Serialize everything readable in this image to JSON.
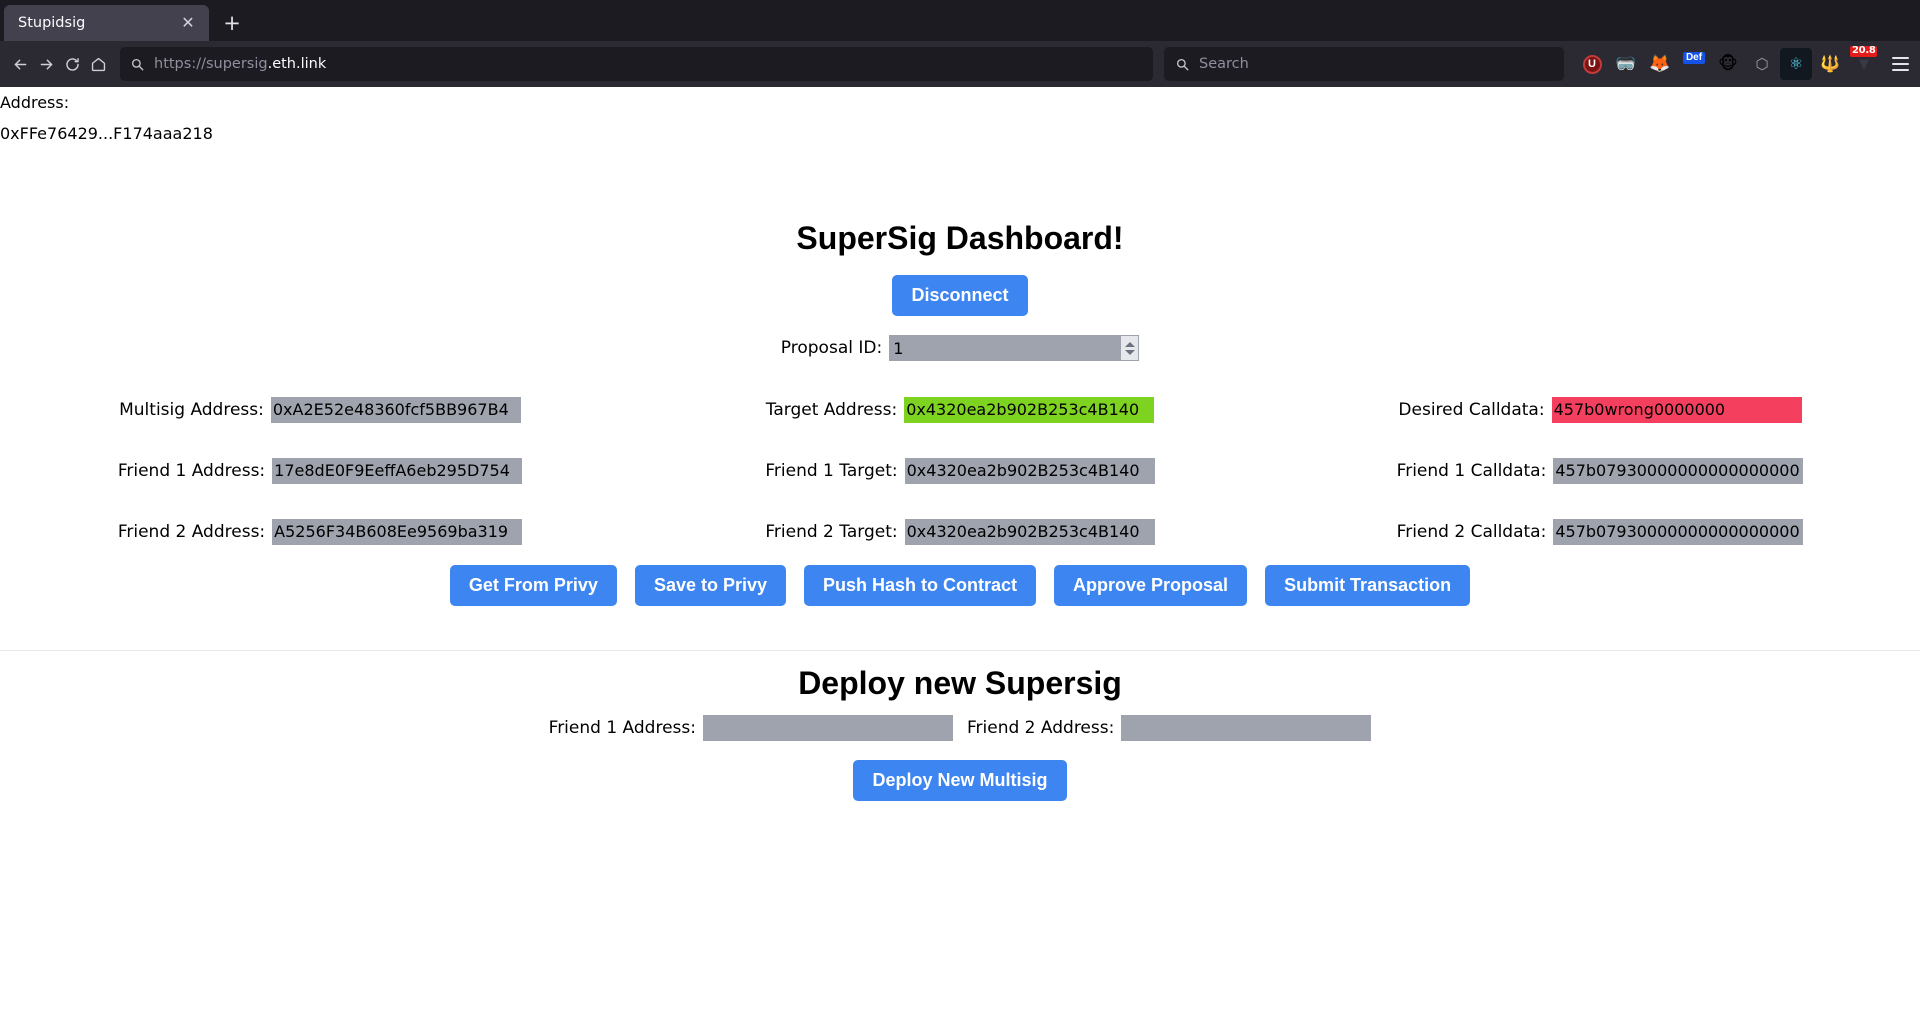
{
  "browser": {
    "tab": {
      "title": "Stupidsig",
      "close_icon": "close-icon"
    },
    "new_tab_icon": "plus-icon",
    "nav": {
      "back_icon": "back-arrow-icon",
      "forward_icon": "forward-arrow-icon",
      "reload_icon": "reload-icon",
      "home_icon": "home-icon"
    },
    "url_bar": {
      "search_icon": "search-icon",
      "prefix": "https://supersig",
      "domain": ".eth.link"
    },
    "search_bar": {
      "search_icon": "search-icon",
      "placeholder": "Search"
    },
    "extensions": [
      {
        "name": "ublock-origin-icon",
        "glyph": "Ⓤ"
      },
      {
        "name": "rabby-wallet-icon",
        "glyph": "🥽"
      },
      {
        "name": "metamask-fox-icon",
        "glyph": "🦊"
      },
      {
        "name": "defillama-icon",
        "glyph": "Def"
      },
      {
        "name": "monkey-wallet-icon",
        "glyph": "🐵"
      },
      {
        "name": "etherscan-icon",
        "glyph": "⬡"
      },
      {
        "name": "react-devtools-icon",
        "glyph": "⚛"
      },
      {
        "name": "tally-wallet-icon",
        "glyph": "🔱"
      },
      {
        "name": "gas-tracker-icon",
        "glyph": "▼",
        "badge": "20.8"
      }
    ],
    "menu_icon": "hamburger-menu-icon"
  },
  "page": {
    "account": {
      "label": "Address:",
      "value": "0xFFe76429...F174aaa218"
    },
    "title": "SuperSig Dashboard!",
    "disconnect_label": "Disconnect",
    "proposal": {
      "label": "Proposal ID:",
      "value": "1"
    },
    "fields": [
      {
        "label": "Multisig Address:",
        "value": "0xA2E52e48360fcf5BB967B4",
        "state": "normal",
        "name": "multisig-address-input"
      },
      {
        "label": "Target Address:",
        "value": "0x4320ea2b902B253c4B140",
        "state": "green",
        "name": "target-address-input"
      },
      {
        "label": "Desired Calldata:",
        "value": "457b0wrong0000000",
        "state": "red",
        "name": "desired-calldata-input"
      },
      {
        "label": "Friend 1 Address:",
        "value": "17e8dE0F9EeffA6eb295D754",
        "state": "normal",
        "name": "friend-1-address-input"
      },
      {
        "label": "Friend 1 Target:",
        "value": "0x4320ea2b902B253c4B140",
        "state": "normal",
        "name": "friend-1-target-input"
      },
      {
        "label": "Friend 1 Calldata:",
        "value": "457b07930000000000000000",
        "state": "normal",
        "name": "friend-1-calldata-input"
      },
      {
        "label": "Friend 2 Address:",
        "value": "A5256F34B608Ee9569ba319",
        "state": "normal",
        "name": "friend-2-address-input"
      },
      {
        "label": "Friend 2 Target:",
        "value": "0x4320ea2b902B253c4B140",
        "state": "normal",
        "name": "friend-2-target-input"
      },
      {
        "label": "Friend 2 Calldata:",
        "value": "457b07930000000000000000",
        "state": "normal",
        "name": "friend-2-calldata-input"
      }
    ],
    "actions": [
      {
        "label": "Get From Privy",
        "name": "get-from-privy-button"
      },
      {
        "label": "Save to Privy",
        "name": "save-to-privy-button"
      },
      {
        "label": "Push Hash to Contract",
        "name": "push-hash-to-contract-button"
      },
      {
        "label": "Approve Proposal",
        "name": "approve-proposal-button"
      },
      {
        "label": "Submit Transaction",
        "name": "submit-transaction-button"
      }
    ],
    "deploy": {
      "title": "Deploy new Supersig",
      "friend1_label": "Friend 1 Address:",
      "friend1_value": "",
      "friend2_label": "Friend 2 Address:",
      "friend2_value": "",
      "button_label": "Deploy New Multisig"
    }
  },
  "colors": {
    "accent_blue": "#3d85f0",
    "field_gray": "#9ea3ae",
    "valid_green": "#7ed321",
    "invalid_red": "#f4405e",
    "chrome_bg": "#2b2a33",
    "tab_strip_bg": "#1c1b22"
  }
}
